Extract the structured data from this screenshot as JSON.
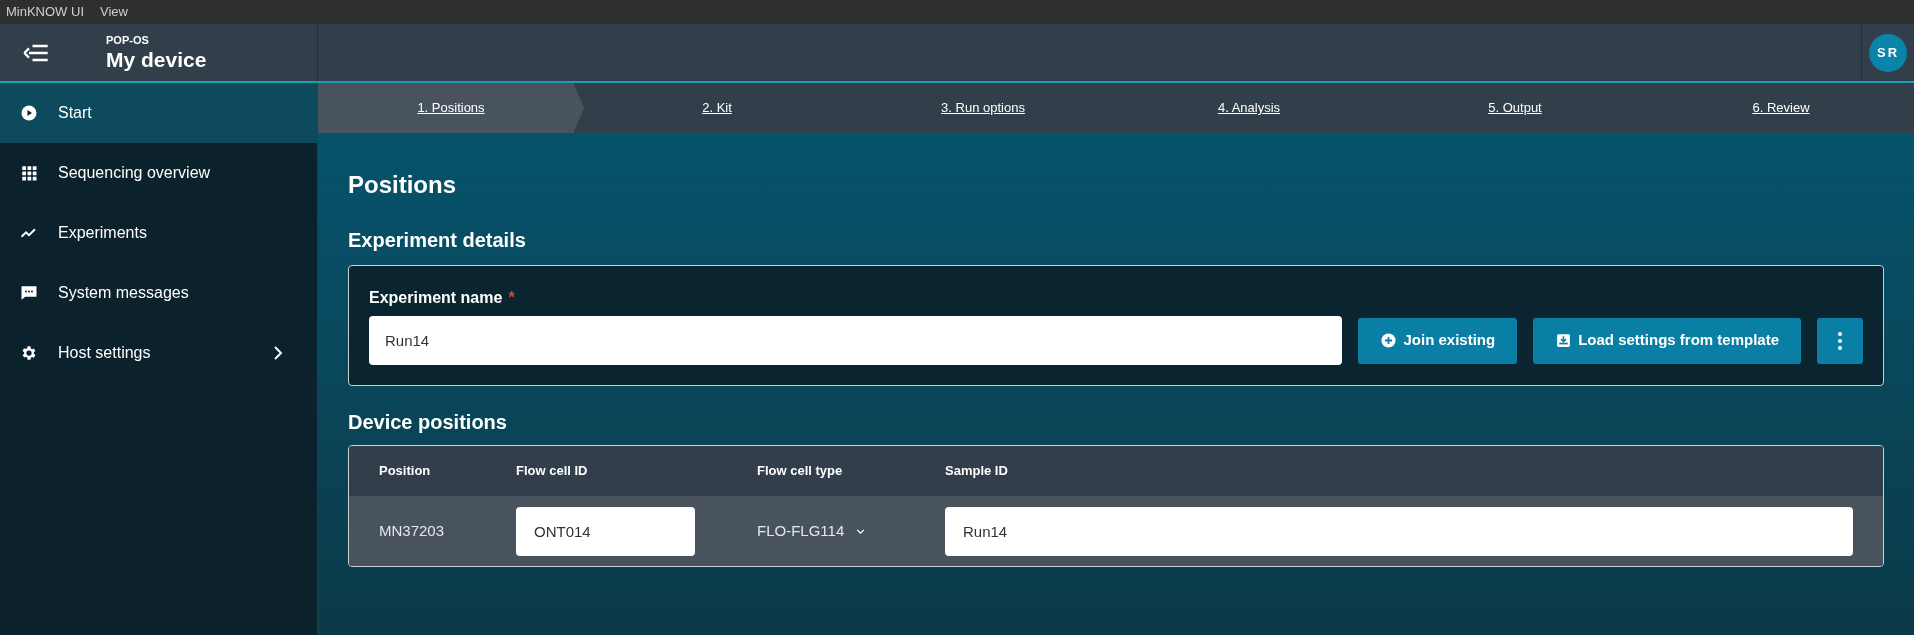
{
  "menu_bar": [
    "MinKNOW UI",
    "View"
  ],
  "header": {
    "host": "POP-OS",
    "device": "My device",
    "avatar": "SR"
  },
  "sidebar": {
    "items": [
      {
        "label": "Start",
        "kind": "play",
        "selected": true,
        "has_arrow": false
      },
      {
        "label": "Sequencing overview",
        "kind": "grid",
        "selected": false,
        "has_arrow": false
      },
      {
        "label": "Experiments",
        "kind": "trend",
        "selected": false,
        "has_arrow": false
      },
      {
        "label": "System messages",
        "kind": "chat",
        "selected": false,
        "has_arrow": false
      },
      {
        "label": "Host settings",
        "kind": "gear",
        "selected": false,
        "has_arrow": true
      }
    ]
  },
  "steps": [
    {
      "label": "1. Positions",
      "selected": true
    },
    {
      "label": "2. Kit",
      "selected": false
    },
    {
      "label": "3. Run options",
      "selected": false
    },
    {
      "label": "4. Analysis",
      "selected": false
    },
    {
      "label": "5. Output",
      "selected": false
    },
    {
      "label": "6. Review",
      "selected": false
    }
  ],
  "page_title": "Positions",
  "experiment_details": {
    "heading": "Experiment details",
    "name_label": "Experiment name",
    "required_mark": "*",
    "name_value": "Run14",
    "buttons": [
      {
        "label": "Join existing",
        "kind": "plus"
      },
      {
        "label": "Load settings from template",
        "kind": "download"
      }
    ]
  },
  "device_positions": {
    "heading": "Device positions",
    "columns": [
      "Position",
      "Flow cell ID",
      "Flow cell type",
      "Sample ID"
    ],
    "rows": [
      {
        "position": "MN37203",
        "flow_cell_id": "ONT014",
        "flow_cell_type": "FLO-FLG114",
        "sample_id": "Run14"
      }
    ]
  }
}
